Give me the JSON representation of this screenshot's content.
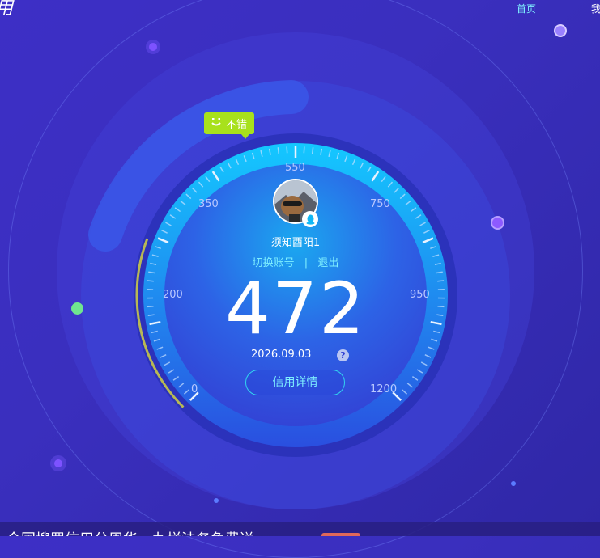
{
  "topnav": {
    "home": "首页",
    "me": "我"
  },
  "corner_glyph": "用",
  "badge": {
    "icon": "smile-icon",
    "label": "不错",
    "color": "#a8e11c"
  },
  "user": {
    "name": "须知酉阳1",
    "switch_account": "切换账号",
    "separator": "|",
    "logout": "退出"
  },
  "score": {
    "value": "472",
    "date": "2026.09.03",
    "help": "?"
  },
  "detail_button": "信用详情",
  "gauge": {
    "min": 0,
    "max": 1200,
    "tick_labels": [
      "0",
      "200",
      "350",
      "550",
      "750",
      "950",
      "1200"
    ],
    "accent": "#00d4ff",
    "arc_color": "#b8b855"
  },
  "bottom_banner": {
    "text": "全国搜罗信用分周华一九样法务免费送",
    "tag_color": "#e0685a"
  }
}
